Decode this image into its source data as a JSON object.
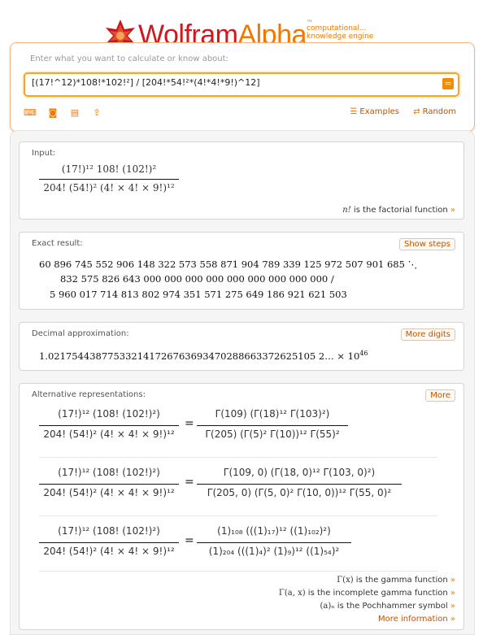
{
  "header": {
    "logo_word_1": "Wolfram",
    "logo_word_2": "Alpha",
    "tm": "™",
    "tagline_1": "computational...",
    "tagline_2": "knowledge engine"
  },
  "search": {
    "hint": "Enter what you want to calculate or know about:",
    "query": "[(17!^12)*108!*102!²] / [204!*54!²*(4!*4!*9!)^12]",
    "submit_icon": "=",
    "tool_icons": [
      "keyboard-icon",
      "camera-icon",
      "table-icon",
      "upload-icon"
    ],
    "examples_label": "Examples",
    "random_label": "Random"
  },
  "input_pod": {
    "title": "Input:",
    "numerator": "(17!)¹² 108! (102!)²",
    "denominator": "204! (54!)² (4! × 4! × 9!)¹²",
    "note_func": "n!",
    "note_text": " is the factorial function",
    "note_arrow": "»"
  },
  "exact_pod": {
    "title": "Exact result:",
    "button": "Show steps",
    "line1": "60 896 745 552 906 148 322 573 558 871 904 789 339 125 972 507 901 685 ⋱",
    "line2": "832 575 826 643 000 000 000 000 000 000 000 000 000 /",
    "line3": "5 960 017 714 813 802 974 351 571 275 649 186 921 621 503"
  },
  "decimal_pod": {
    "title": "Decimal approximation:",
    "button": "More digits",
    "value": "1.021754438775332141726763693470288663372625105 2…",
    "times": " × 10",
    "exponent": "46"
  },
  "alt_pod": {
    "title": "Alternative representations:",
    "button": "More",
    "lhs_num": "(17!)¹² (108! (102!)²)",
    "lhs_den": "204! (54!)² (4! × 4! × 9!)¹²",
    "eq": "=",
    "rows": [
      {
        "num": "Γ(109) (Γ(18)¹² Γ(103)²)",
        "den": "Γ(205) (Γ(5)² Γ(10))¹² Γ(55)²"
      },
      {
        "num": "Γ(109, 0) (Γ(18, 0)¹² Γ(103, 0)²)",
        "den": "Γ(205, 0) (Γ(5, 0)² Γ(10, 0))¹² Γ(55, 0)²"
      },
      {
        "num": "(1)₁₀₈ (((1)₁₇)¹² ((1)₁₀₂)²)",
        "den": "(1)₂₀₄ (((1)₄)² (1)₉)¹² ((1)₅₄)²"
      }
    ],
    "notes": [
      {
        "func": "Γ(x)",
        "text": " is the gamma function"
      },
      {
        "func": "Γ(a, x)",
        "text": " is the incomplete gamma function"
      },
      {
        "func": "(a)ₙ",
        "text": " is the Pochhammer symbol"
      }
    ],
    "more_info": "More information",
    "arrow": "»"
  }
}
